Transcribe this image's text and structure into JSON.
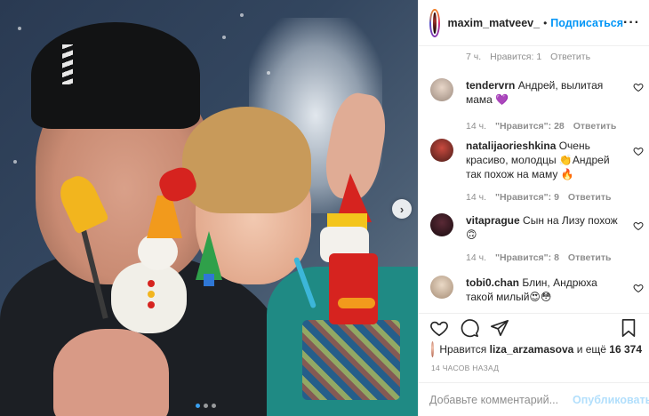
{
  "post": {
    "username": "maxim_matveev_",
    "separator": "•",
    "follow_label": "Подписаться",
    "more_label": "···"
  },
  "photo": {
    "next_icon": "›",
    "carousel_dots": 3,
    "active_dot": 0
  },
  "first_comment_meta": {
    "time": "7 ч.",
    "likes": "Нравится: 1",
    "reply": "Ответить"
  },
  "comments": [
    {
      "user": "tendervrn",
      "text": "Андрей, вылитая мама 💜",
      "time": "14 ч.",
      "likes": "\"Нравится\": 28",
      "reply": "Ответить"
    },
    {
      "user": "natalijaorieshkina",
      "text": "Очень красиво, молодцы 👏Андрей так похож на маму 🔥",
      "time": "14 ч.",
      "likes": "\"Нравится\": 9",
      "reply": "Ответить"
    },
    {
      "user": "vitaprague",
      "text": "Сын на Лизу похож 🙃",
      "time": "14 ч.",
      "likes": "\"Нравится\": 8",
      "reply": "Ответить"
    },
    {
      "user": "tobi0.chan",
      "text": "Блин, Андрюха такой милый😍😳",
      "time": "",
      "likes": "",
      "reply": ""
    }
  ],
  "likes_row": {
    "prefix": "Нравится",
    "user": "liza_arzamasova",
    "middle": "и ещё",
    "count": "16 374"
  },
  "time_ago": "14 ЧАСОВ НАЗАД",
  "add_comment": {
    "placeholder": "Добавьте комментарий...",
    "post_label": "Опубликовать"
  },
  "colors": {
    "link_blue": "#0095f6",
    "muted": "#8e8e8e",
    "post_disabled": "#b2dffc"
  },
  "icons": [
    "heart-icon",
    "comment-icon",
    "share-icon",
    "bookmark-icon",
    "more-icon",
    "chevron-right-icon"
  ]
}
